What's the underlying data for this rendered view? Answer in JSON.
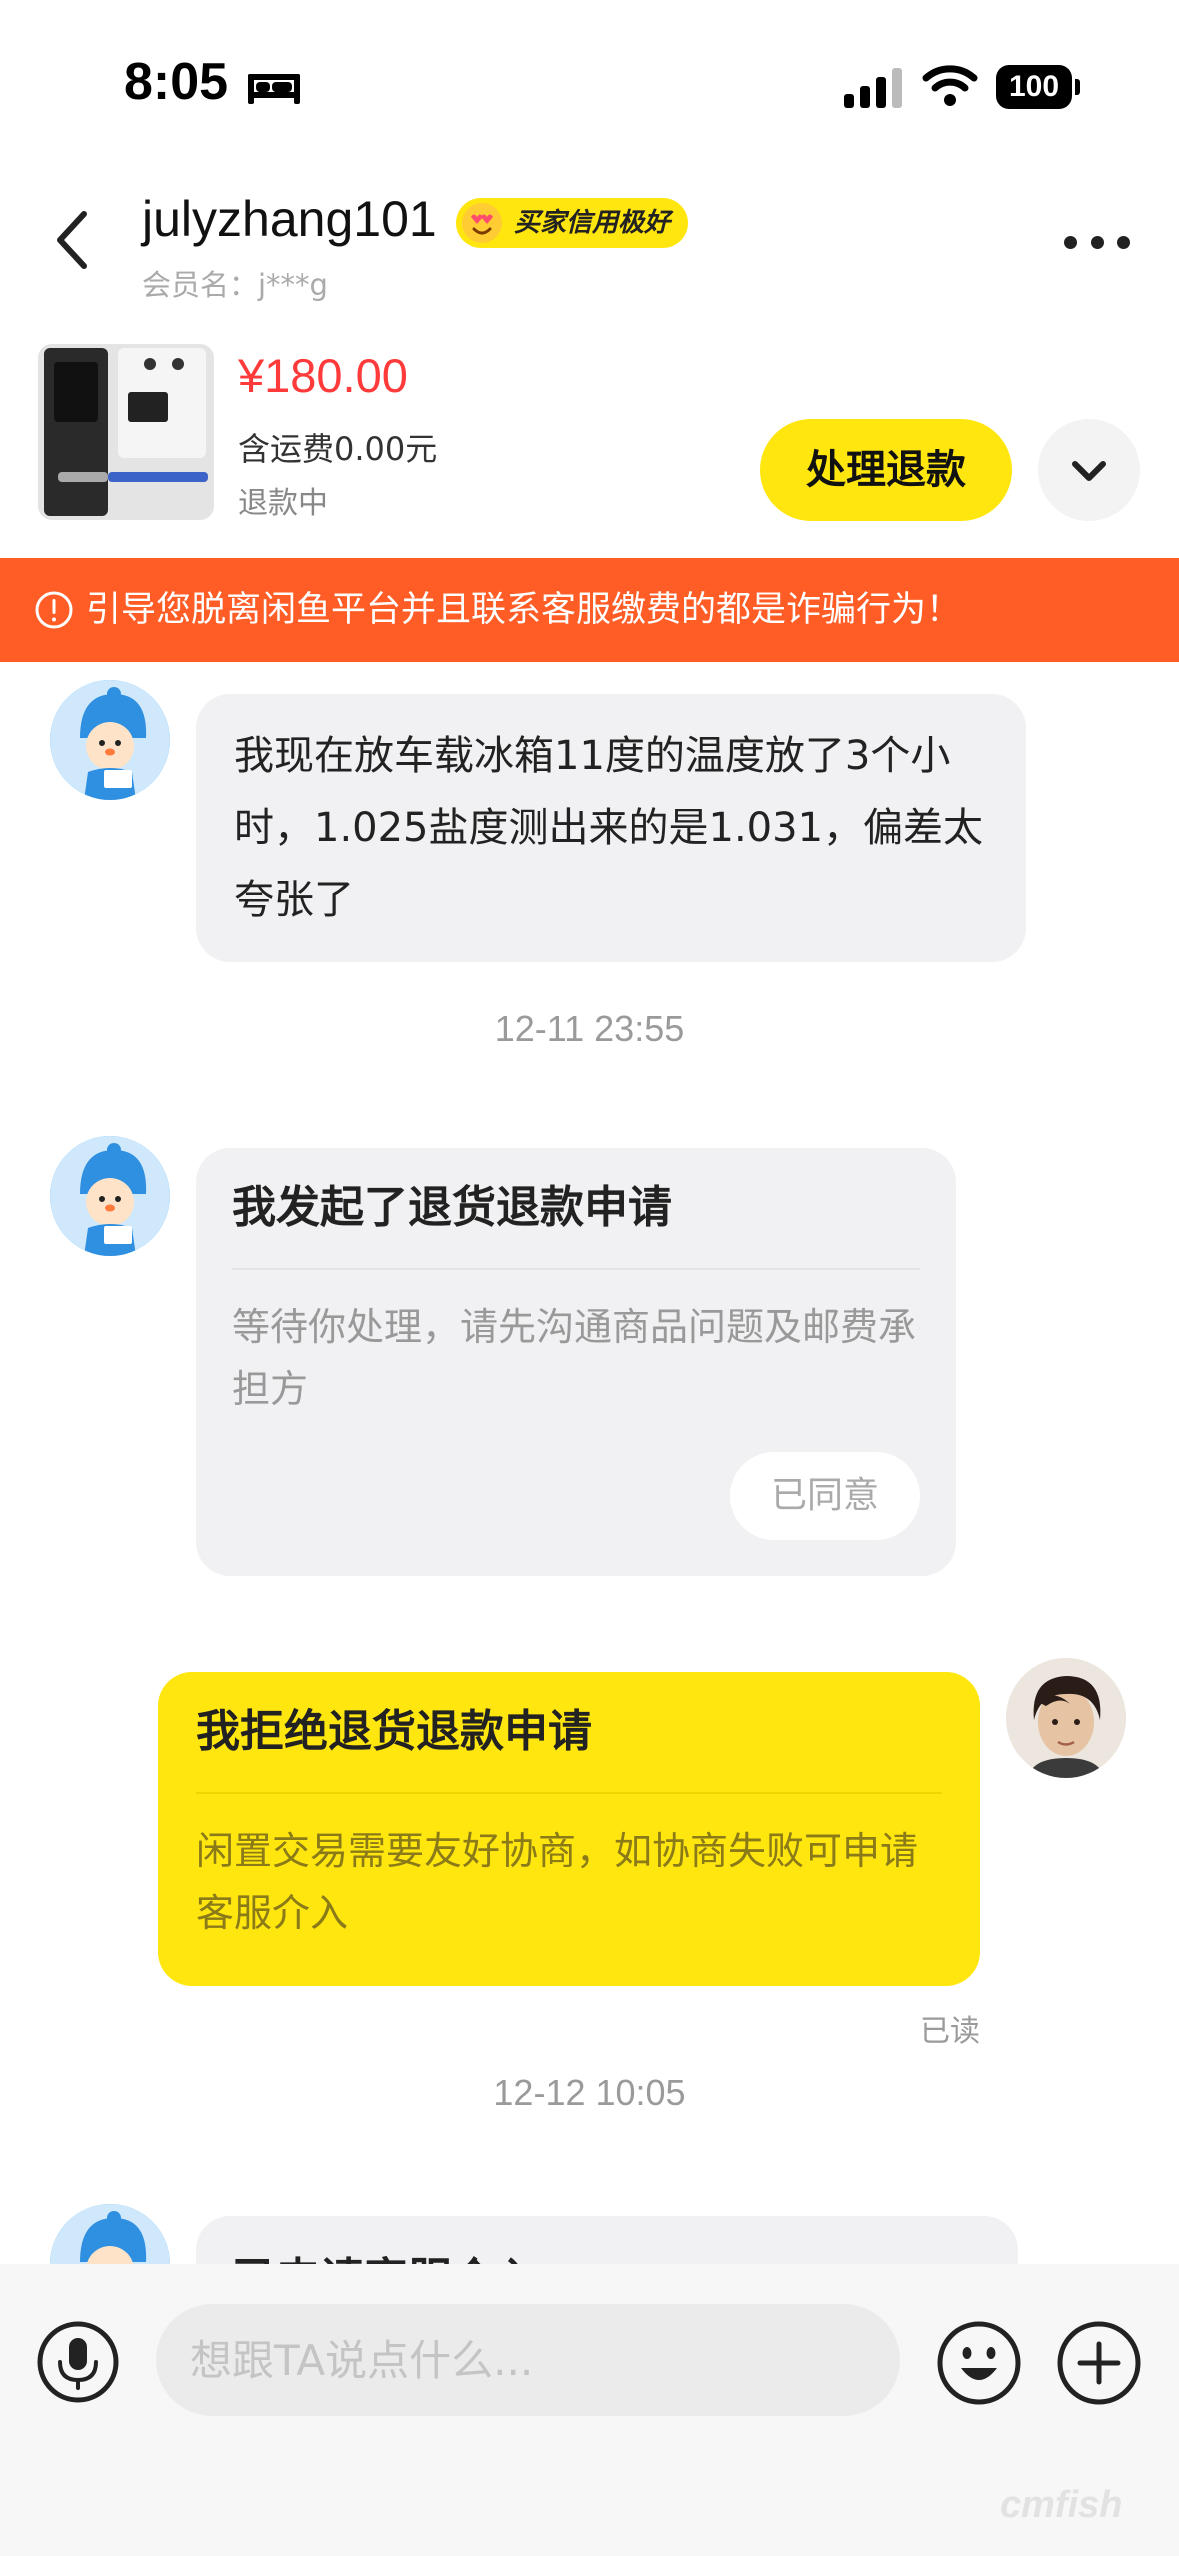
{
  "status_bar": {
    "time": "8:05",
    "battery": "100",
    "icons": [
      "bed-icon",
      "signal-icon",
      "wifi-icon",
      "battery-icon"
    ]
  },
  "header": {
    "username": "julyzhang101",
    "credit_badge": "买家信用极好",
    "member_name": "会员名：j***g"
  },
  "product": {
    "price": "¥180.00",
    "shipping": "含运费0.00元",
    "status": "退款中",
    "action_button": "处理退款"
  },
  "warning": {
    "text": "引导您脱离闲鱼平台并且联系客服缴费的都是诈骗行为！"
  },
  "messages": {
    "msg1": {
      "sender": "buyer",
      "text": "我现在放车载冰箱11度的温度放了3个小时，1.025盐度测出来的是1.031，偏差太夸张了"
    },
    "time1": "12-11 23:55",
    "card1": {
      "sender": "buyer",
      "title": "我发起了退货退款申请",
      "desc": "等待你处理，请先沟通商品问题及邮费承担方",
      "button": "已同意"
    },
    "card2": {
      "sender": "seller",
      "title": "我拒绝退货退款申请",
      "desc": "闲置交易需要友好协商，如协商失败可申请客服介入",
      "status": "已读"
    },
    "time2": "12-12 10:05",
    "card3": {
      "sender": "buyer",
      "title": "已申请客服介入"
    }
  },
  "input": {
    "placeholder": "想跟TA说点什么..."
  },
  "watermark": "cmfish",
  "colors": {
    "accent_yellow": "#ffe60f",
    "warning_orange": "#ff5c26",
    "price_red": "#ff3a3a",
    "bubble_gray": "#f1f1f3"
  }
}
